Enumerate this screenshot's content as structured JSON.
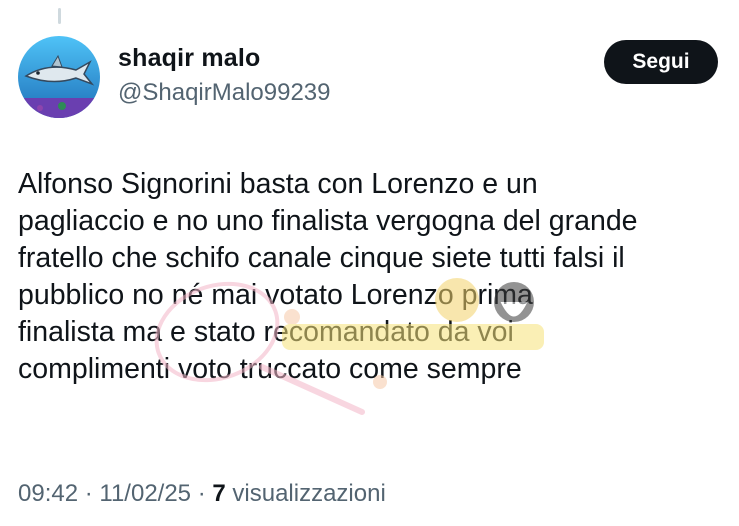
{
  "user": {
    "display_name": "shaqir malo",
    "handle": "@ShaqirMalo99239",
    "avatar_icon": "shark-avatar-icon"
  },
  "actions": {
    "follow_label": "Segui"
  },
  "tweet": {
    "lines": [
      "Alfonso Signorini basta con Lorenzo e un",
      "pagliaccio e no uno finalista vergogna del grande",
      "fratello che schifo canale cinque siete tutti falsi il",
      "pubblico no né mai votato Lorenzo prima",
      "finalista ma e stato recomandato da voi",
      "complimenti voto truccato come sempre"
    ]
  },
  "meta": {
    "time": "09:42",
    "sep1": " · ",
    "date": "11/02/25",
    "sep2": " · ",
    "views_count": "7",
    "views_label": " visualizzazioni"
  },
  "watermark": {
    "icon": "watermark-logo-icon"
  },
  "colors": {
    "text": "#0f1419",
    "secondary": "#536471",
    "button_bg": "#0f1419",
    "button_text": "#ffffff"
  }
}
